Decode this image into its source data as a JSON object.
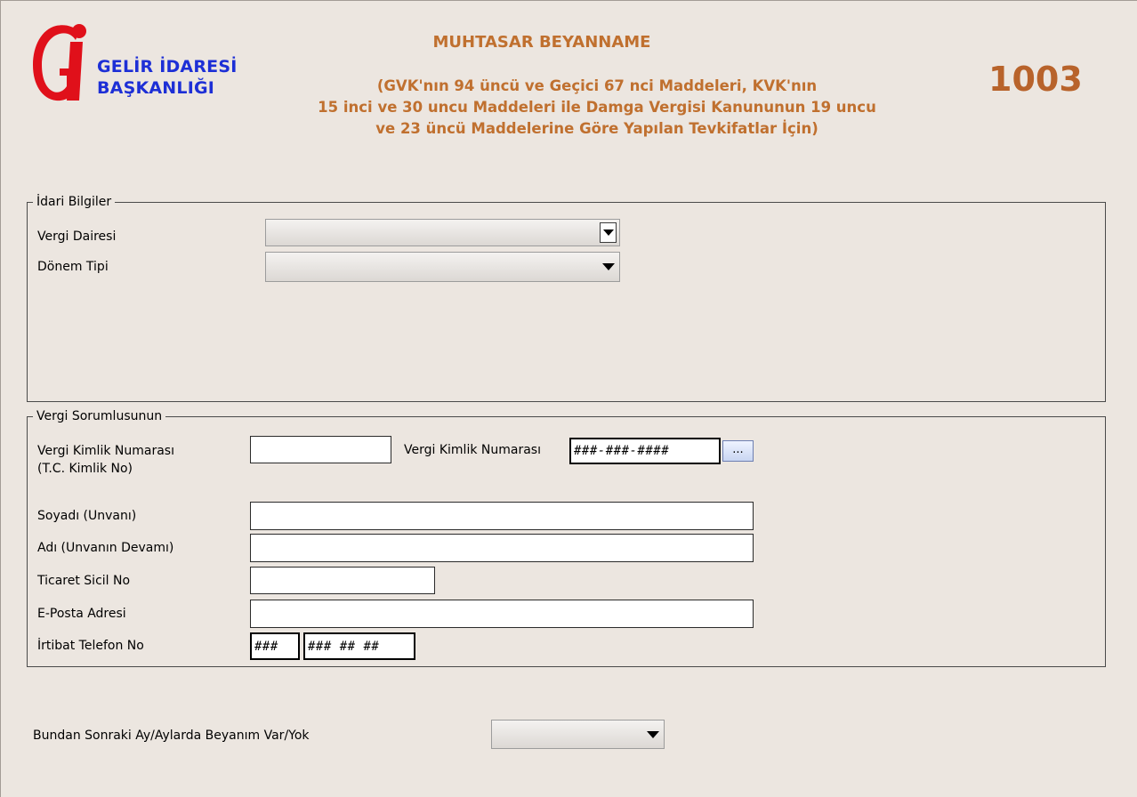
{
  "header": {
    "logo_text": "GELİR İDARESİ\nBAŞKANLIĞI",
    "title": "MUHTASAR BEYANNAME",
    "subtitle": "(GVK'nın 94 üncü ve Geçici 67 nci Maddeleri, KVK'nın\n15 inci ve 30 uncu Maddeleri ile Damga Vergisi Kanununun 19 uncu\nve 23 üncü Maddelerine Göre Yapılan Tevkifatlar İçin)",
    "form_code": "1003",
    "logo_icon": "gib-logo-icon",
    "colors": {
      "title": "#c0702f",
      "logo_text": "#1d2fd6",
      "logo_mark": "#e0101a"
    }
  },
  "idari_bilgiler": {
    "legend": "İdari Bilgiler",
    "vergi_dairesi_label": "Vergi Dairesi",
    "vergi_dairesi_value": "",
    "donem_tipi_label": "Dönem Tipi",
    "donem_tipi_value": ""
  },
  "vergi_sorumlusu": {
    "legend": "Vergi Sorumlusunun",
    "vkn_tc_label": "Vergi Kimlik Numarası\n(T.C. Kimlik No)",
    "vkn_tc_value": "",
    "vkn_label": "Vergi Kimlik Numarası",
    "vkn_value": "###-###-####",
    "vkn_button_label": "...",
    "soyadi_label": "Soyadı (Unvanı)",
    "soyadi_value": "",
    "adi_label": "Adı (Unvanın Devamı)",
    "adi_value": "",
    "ticaret_sicil_label": "Ticaret Sicil No",
    "ticaret_sicil_value": "",
    "eposta_label": "E-Posta Adresi",
    "eposta_value": "",
    "telefon_label": "İrtibat Telefon No",
    "telefon_alan_kodu": "###",
    "telefon_numara": "### ## ##"
  },
  "sonraki_beyan": {
    "label": "Bundan Sonraki Ay/Aylarda Beyanım Var/Yok",
    "value": ""
  }
}
